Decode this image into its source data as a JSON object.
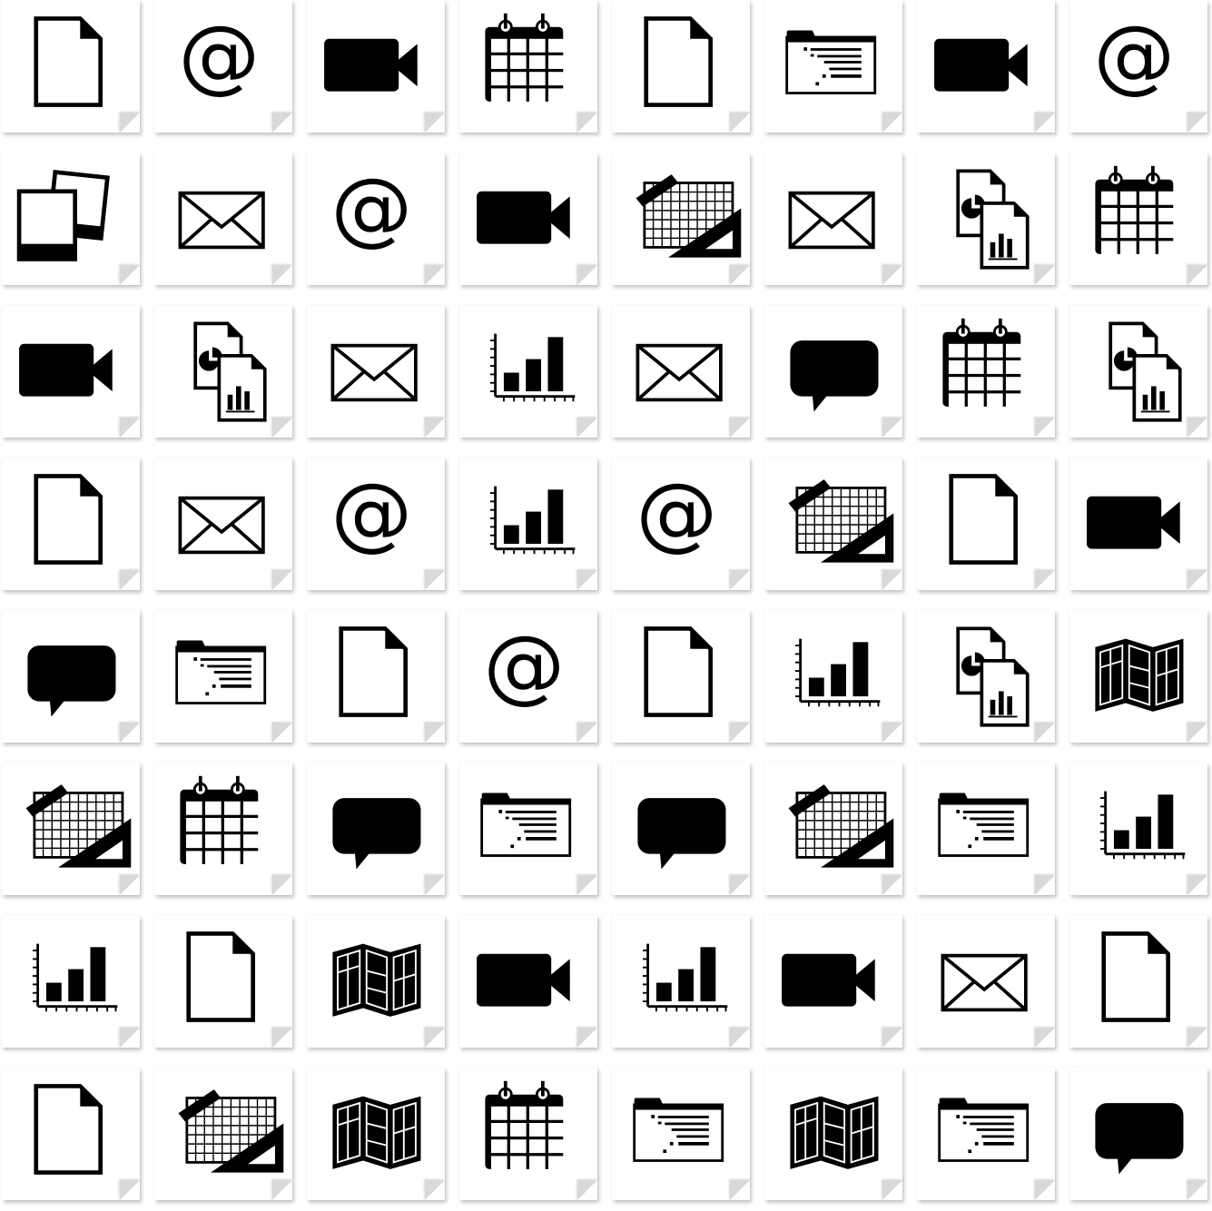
{
  "icon_color": "#000000",
  "tile_color": "#ffffff",
  "rows": [
    [
      "document-icon",
      "at-sign-icon",
      "video-camera-icon",
      "calendar-icon",
      "document-icon",
      "folder-list-icon",
      "video-camera-icon",
      "at-sign-icon"
    ],
    [
      "photos-icon",
      "envelope-icon",
      "at-sign-icon",
      "video-camera-icon",
      "blueprint-icon",
      "envelope-icon",
      "report-files-icon",
      "calendar-icon"
    ],
    [
      "video-camera-icon",
      "report-files-icon",
      "envelope-icon",
      "bar-chart-icon",
      "envelope-icon",
      "speech-bubble-icon",
      "calendar-icon",
      "report-files-icon"
    ],
    [
      "document-icon",
      "envelope-icon",
      "at-sign-icon",
      "bar-chart-icon",
      "at-sign-icon",
      "blueprint-icon",
      "document-icon",
      "video-camera-icon"
    ],
    [
      "speech-bubble-icon",
      "folder-list-icon",
      "document-icon",
      "at-sign-icon",
      "document-icon",
      "bar-chart-icon",
      "report-files-icon",
      "map-icon"
    ],
    [
      "blueprint-icon",
      "calendar-icon",
      "speech-bubble-icon",
      "folder-list-icon",
      "speech-bubble-icon",
      "blueprint-icon",
      "folder-list-icon",
      "bar-chart-icon"
    ],
    [
      "bar-chart-icon",
      "document-icon",
      "map-icon",
      "video-camera-icon",
      "bar-chart-icon",
      "video-camera-icon",
      "envelope-icon",
      "document-icon"
    ],
    [
      "document-icon",
      "blueprint-icon",
      "map-icon",
      "calendar-icon",
      "folder-list-icon",
      "map-icon",
      "folder-list-icon",
      "speech-bubble-icon"
    ]
  ]
}
